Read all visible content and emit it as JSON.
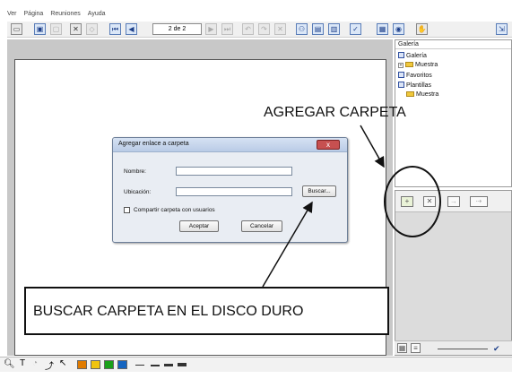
{
  "menu": [
    "Ver",
    "Página",
    "Reuniones",
    "Ayuda"
  ],
  "toolbar": {
    "page_indicator": "2 de 2"
  },
  "gallery": {
    "title": "Galería",
    "tree": [
      {
        "label": "Galería",
        "kind": "check"
      },
      {
        "label": "Muestra",
        "kind": "folder-plus"
      },
      {
        "label": "Favoritos",
        "kind": "check"
      },
      {
        "label": "Plantillas",
        "kind": "check"
      },
      {
        "label": "Muestra",
        "kind": "folder"
      }
    ]
  },
  "dialog": {
    "title": "Agregar enlace a carpeta",
    "close": "x",
    "name_label": "Nombre:",
    "name_value": "",
    "location_label": "Ubicación:",
    "location_value": "",
    "browse_button": "Buscar...",
    "share_checkbox_label": "Compartir carpeta con usuarios",
    "accept_button": "Aceptar",
    "cancel_button": "Cancelar"
  },
  "annotations": {
    "add_folder": "AGREGAR CARPETA",
    "browse_disk": "BUSCAR CARPETA EN EL DISCO DURO"
  },
  "colors": {
    "swatches": [
      "#e07b00",
      "#f1c40f",
      "#1aa01a",
      "#1565c0"
    ]
  }
}
